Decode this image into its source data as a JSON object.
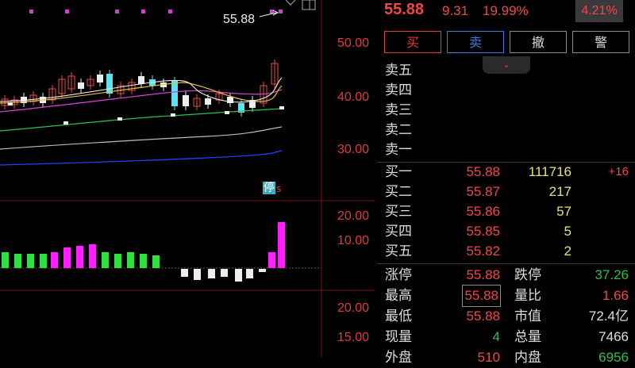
{
  "chart": {
    "axis_upper": [
      "50.00",
      "40.00",
      "30.00"
    ],
    "axis_vol": [
      "20.00",
      "10.00"
    ],
    "axis_lower": [
      "20.00",
      "15.00"
    ],
    "high_marker": "55.88",
    "limit_flag": "停"
  },
  "quote": {
    "price": "55.88",
    "change": "9.31",
    "change_pct": "19.99%",
    "turnover": "4.21%"
  },
  "buttons": {
    "buy": "买",
    "sell": "卖",
    "cancel": "撤",
    "alert": "警"
  },
  "asks": [
    {
      "label": "卖五",
      "price": "",
      "vol": ""
    },
    {
      "label": "卖四",
      "price": "",
      "vol": ""
    },
    {
      "label": "卖三",
      "price": "",
      "vol": ""
    },
    {
      "label": "卖二",
      "price": "",
      "vol": ""
    },
    {
      "label": "卖一",
      "price": "",
      "vol": ""
    }
  ],
  "bids": [
    {
      "label": "买一",
      "price": "55.88",
      "vol": "111716",
      "delta": "+16"
    },
    {
      "label": "买二",
      "price": "55.87",
      "vol": "217",
      "delta": ""
    },
    {
      "label": "买三",
      "price": "55.86",
      "vol": "57",
      "delta": ""
    },
    {
      "label": "买四",
      "price": "55.85",
      "vol": "5",
      "delta": ""
    },
    {
      "label": "买五",
      "price": "55.82",
      "vol": "2",
      "delta": ""
    }
  ],
  "stats": [
    {
      "l1": "涨停",
      "v1": "55.88",
      "c1": "red",
      "l2": "跌停",
      "v2": "37.26",
      "c2": "green"
    },
    {
      "l1": "最高",
      "v1": "55.88",
      "c1": "red",
      "l2": "量比",
      "v2": "1.66",
      "c2": "red"
    },
    {
      "l1": "最低",
      "v1": "55.88",
      "c1": "red",
      "l2": "市值",
      "v2": "72.4亿",
      "c2": "white"
    },
    {
      "l1": "现量",
      "v1": "4",
      "c1": "green",
      "l2": "总量",
      "v2": "7466",
      "c2": "white"
    },
    {
      "l1": "外盘",
      "v1": "510",
      "c1": "red",
      "l2": "内盘",
      "v2": "6956",
      "c2": "green"
    }
  ],
  "colors": {
    "up": "#f04848",
    "down": "#2fbf4a",
    "ma_purple": "#d040d0",
    "ma_yellow": "#e8c040",
    "ma_green": "#30c050",
    "ma_blue": "#2040ff"
  }
}
